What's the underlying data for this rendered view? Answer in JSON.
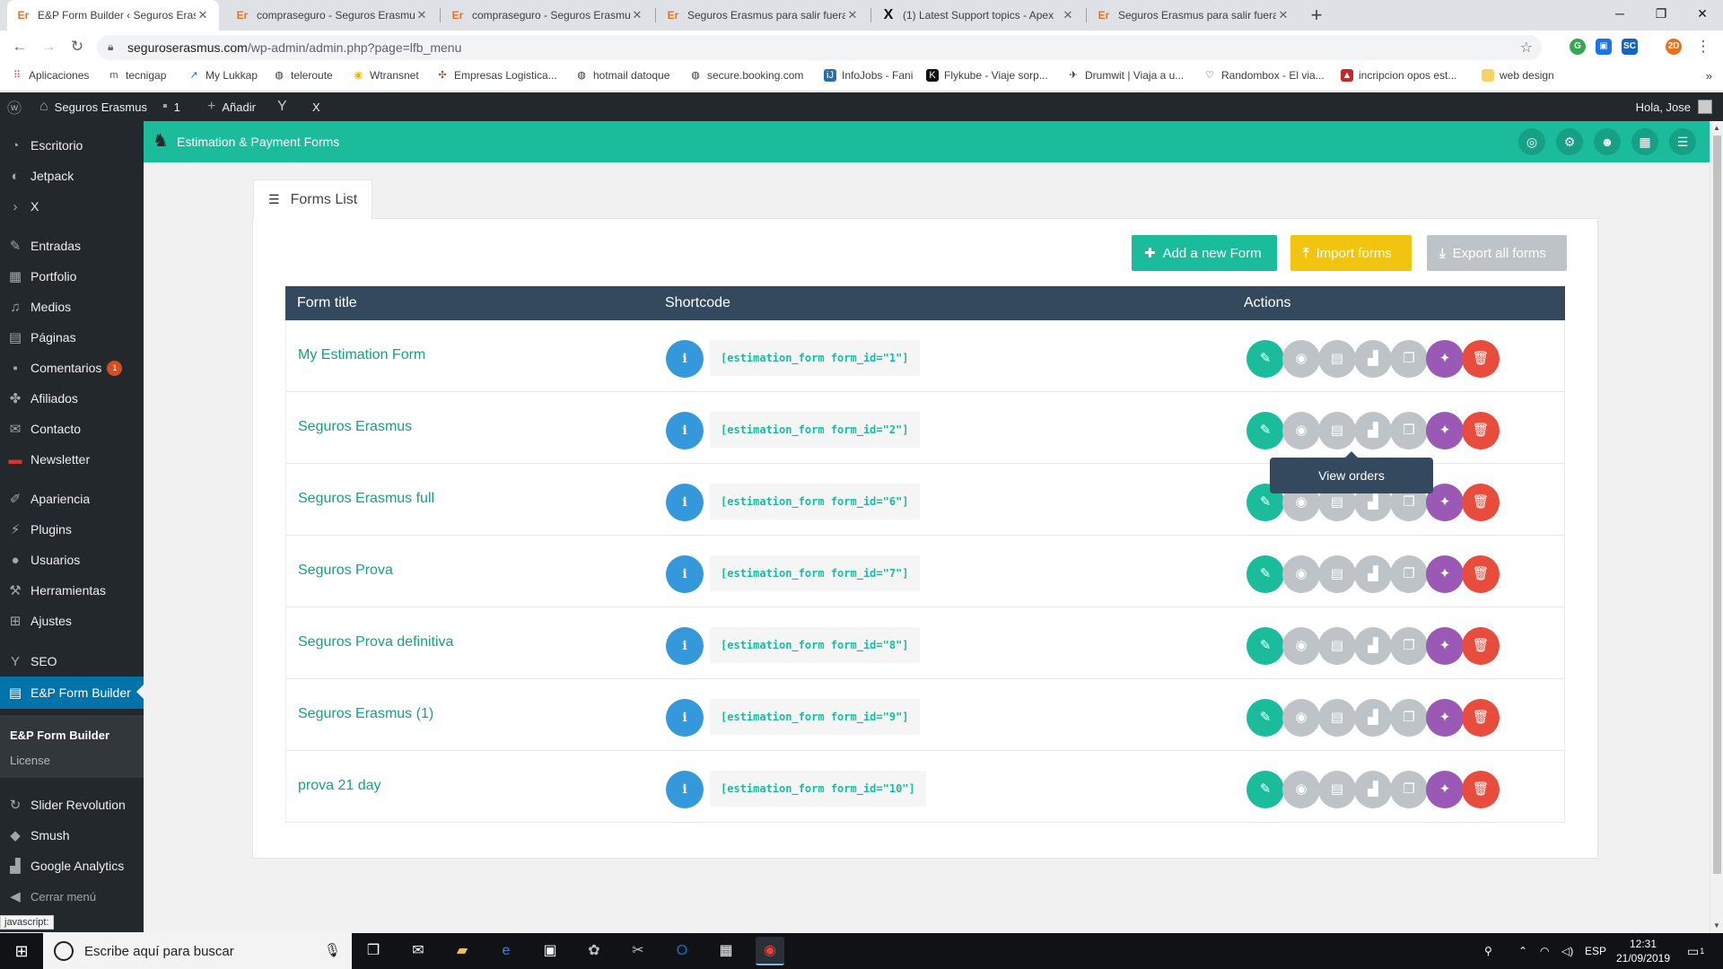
{
  "browser": {
    "tabs": [
      {
        "title": "E&P Form Builder ‹ Seguros Erasmus",
        "favicon": "Er",
        "active": true
      },
      {
        "title": "compraseguro - Seguros Erasmus",
        "favicon": "Er"
      },
      {
        "title": "compraseguro - Seguros Erasmus",
        "favicon": "Er"
      },
      {
        "title": "Seguros Erasmus para salir fuera",
        "favicon": "Er"
      },
      {
        "title": "(1) Latest Support topics - Apex",
        "favicon": "X"
      },
      {
        "title": "Seguros Erasmus para salir fuera",
        "favicon": "Er"
      }
    ],
    "url_host": "seguroserasmus.com",
    "url_path": "/wp-admin/admin.php?page=lfb_menu",
    "bookmarks": [
      "Aplicaciones",
      "tecnigap",
      "My Lukkap",
      "teleroute",
      "Wtransnet",
      "Empresas Logistica...",
      "hotmail datoque",
      "secure.booking.com",
      "InfoJobs - Fani",
      "Flykube - Viaje sorp...",
      "Drumwit | Viaja a u...",
      "Randombox - El via...",
      "incripcion opos est...",
      "web design"
    ],
    "more_bookmarks": "»",
    "status_text": "javascript:"
  },
  "adminbar": {
    "site_name": "Seguros Erasmus",
    "comments_count": "1",
    "add_new": "Añadir",
    "x_label": "X",
    "greeting": "Hola, Jose"
  },
  "sidebar": {
    "items": [
      {
        "label": "Escritorio",
        "icon": "dashboard-icon"
      },
      {
        "label": "Jetpack",
        "icon": "jetpack-icon"
      },
      {
        "label": "X",
        "icon": "chevron-right-icon"
      },
      {
        "label": "Entradas",
        "icon": "pin-icon"
      },
      {
        "label": "Portfolio",
        "icon": "portfolio-icon"
      },
      {
        "label": "Medios",
        "icon": "media-icon"
      },
      {
        "label": "Páginas",
        "icon": "pages-icon"
      },
      {
        "label": "Comentarios",
        "icon": "comments-icon",
        "badge": "1"
      },
      {
        "label": "Afiliados",
        "icon": "affiliates-icon"
      },
      {
        "label": "Contacto",
        "icon": "mail-icon"
      },
      {
        "label": "Newsletter",
        "icon": "newsletter-icon"
      },
      {
        "label": "Apariencia",
        "icon": "brush-icon"
      },
      {
        "label": "Plugins",
        "icon": "plugin-icon"
      },
      {
        "label": "Usuarios",
        "icon": "user-icon"
      },
      {
        "label": "Herramientas",
        "icon": "wrench-icon"
      },
      {
        "label": "Ajustes",
        "icon": "settings-icon"
      },
      {
        "label": "SEO",
        "icon": "yoast-icon"
      },
      {
        "label": "E&P Form Builder",
        "icon": "form-icon",
        "current": true
      },
      {
        "label": "Slider Revolution",
        "icon": "slider-icon"
      },
      {
        "label": "Smush",
        "icon": "smush-icon"
      },
      {
        "label": "Google Analytics",
        "icon": "analytics-icon"
      },
      {
        "label": "Cerrar menú",
        "icon": "collapse-icon"
      }
    ],
    "submenu": [
      "E&P Form Builder",
      "License"
    ]
  },
  "plugin": {
    "title": "Estimation & Payment Forms",
    "header_buttons": [
      "eye-slash-icon",
      "cogs-icon",
      "users-icon",
      "calendar-icon",
      "list-icon"
    ]
  },
  "forms_tab": {
    "label": "Forms List"
  },
  "actions_bar": {
    "add_label": "Add a new Form",
    "import_label": "Import forms",
    "export_label": "Export all forms"
  },
  "table": {
    "headers": [
      "Form title",
      "Shortcode",
      "Actions"
    ],
    "rows": [
      {
        "title": "My Estimation Form",
        "shortcode": "[estimation_form form_id=\"1\"]"
      },
      {
        "title": "Seguros Erasmus",
        "shortcode": "[estimation_form form_id=\"2\"]"
      },
      {
        "title": "Seguros Erasmus full",
        "shortcode": "[estimation_form form_id=\"6\"]"
      },
      {
        "title": "Seguros Prova",
        "shortcode": "[estimation_form form_id=\"7\"]"
      },
      {
        "title": "Seguros Prova definitiva",
        "shortcode": "[estimation_form form_id=\"8\"]"
      },
      {
        "title": "Seguros Erasmus (1)",
        "shortcode": "[estimation_form form_id=\"9\"]"
      },
      {
        "title": "prova 21 day",
        "shortcode": "[estimation_form form_id=\"10\"]"
      }
    ]
  },
  "tooltip": {
    "text": "View orders"
  },
  "taskbar": {
    "search_placeholder": "Escribe aquí para buscar",
    "lang": "ESP",
    "time": "12:31",
    "date": "21/09/2019",
    "notifications": "1"
  },
  "colors": {
    "accent": "#1abc9c",
    "wp_dark": "#23282d",
    "table_header": "#34495e",
    "info": "#3498db",
    "import": "#f1c40f",
    "export": "#bdc3c7",
    "wand": "#9b59b6",
    "delete": "#e74c3c"
  }
}
